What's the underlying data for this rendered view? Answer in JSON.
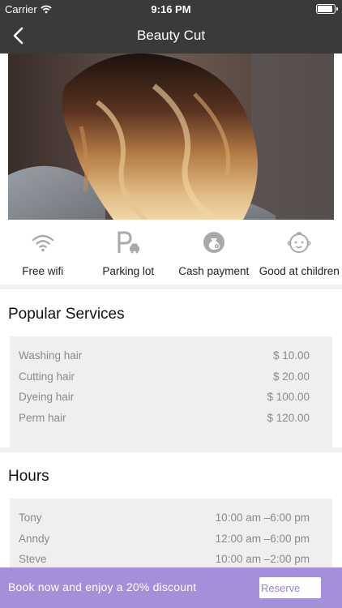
{
  "status_bar": {
    "carrier": "Carrier",
    "time": "9:16 PM"
  },
  "nav": {
    "title": "Beauty Cut"
  },
  "amenities": [
    {
      "icon": "wifi-icon",
      "label": "Free wifi"
    },
    {
      "icon": "parking-icon",
      "label": "Parking lot"
    },
    {
      "icon": "money-bag-icon",
      "label": "Cash payment"
    },
    {
      "icon": "baby-face-icon",
      "label": "Good at children"
    }
  ],
  "services": {
    "title": "Popular Services",
    "items": [
      {
        "name": "Washing hair",
        "price": "$ 10.00"
      },
      {
        "name": "Cutting hair",
        "price": "$ 20.00"
      },
      {
        "name": "Dyeing hair",
        "price": "$ 100.00"
      },
      {
        "name": "Perm hair",
        "price": "$ 120.00"
      }
    ]
  },
  "hours": {
    "title": "Hours",
    "items": [
      {
        "name": "Tony",
        "time": "10:00 am –6:00 pm"
      },
      {
        "name": "Anndy",
        "time": "12:00 am –6:00 pm"
      },
      {
        "name": "Steve",
        "time": "10:00 am –2:00 pm"
      }
    ]
  },
  "promo": {
    "text": "Book now and enjoy a 20% discount",
    "button": "Reserve"
  },
  "colors": {
    "bar": "#3a3a3a",
    "accent": "#a58fd8",
    "panel": "#efefef"
  }
}
